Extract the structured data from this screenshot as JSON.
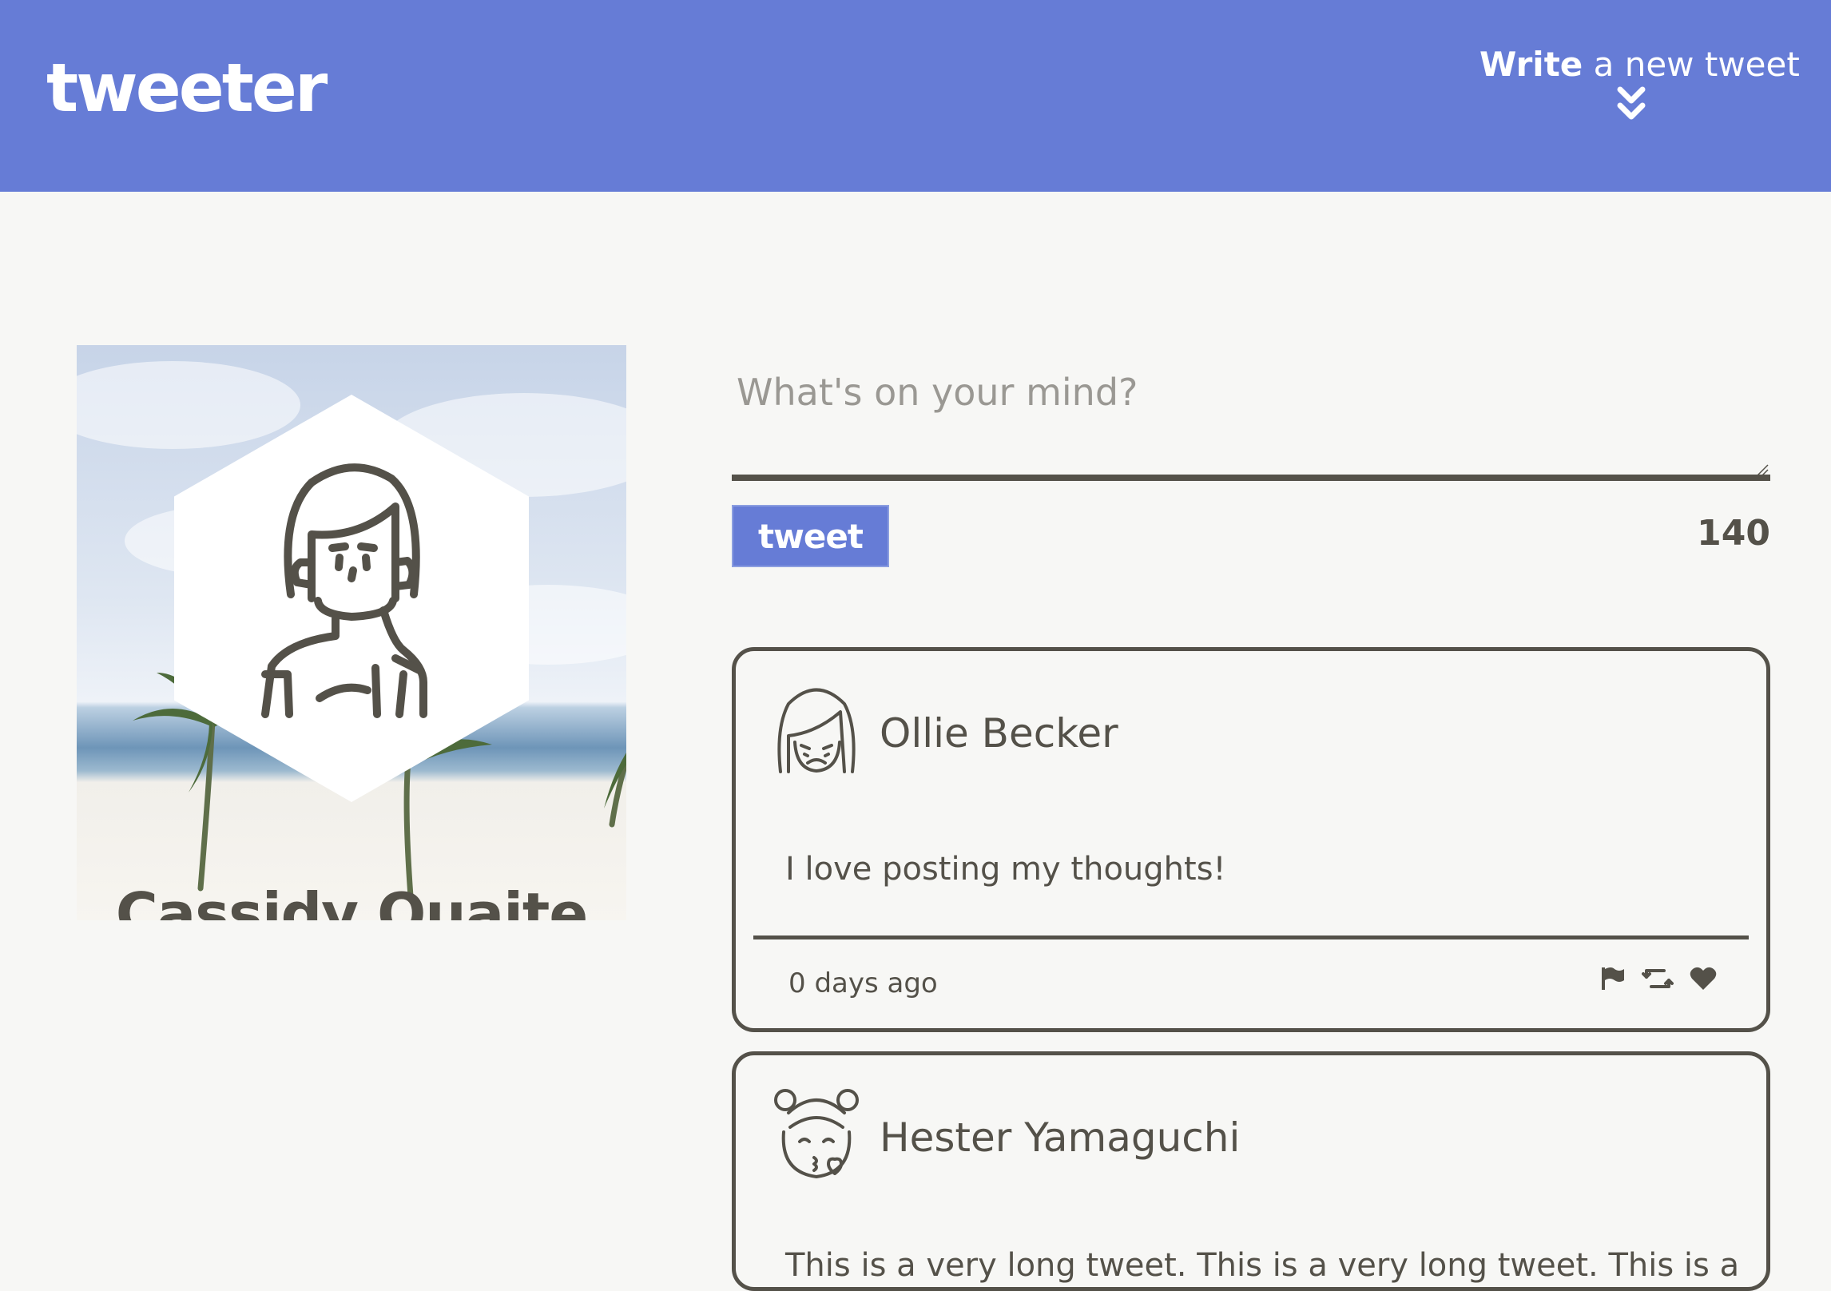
{
  "nav": {
    "brand": "tweeter",
    "compose_toggle_strong": "Write",
    "compose_toggle_rest": " a new tweet",
    "toggle_icon": "double-chevron-down-icon"
  },
  "profile": {
    "name": "Cassidy Quaite",
    "avatar_icon": "woman-avatar-icon"
  },
  "compose": {
    "placeholder": "What's on your mind?",
    "value": "",
    "button_label": "tweet",
    "counter": "140"
  },
  "tweets": [
    {
      "author": "Ollie Becker",
      "avatar_icon": "sad-girl-avatar-icon",
      "content": "I love posting my thoughts!",
      "time": "0 days ago",
      "actions": [
        "flag-icon",
        "retweet-icon",
        "heart-icon"
      ]
    },
    {
      "author": "Hester Yamaguchi",
      "avatar_icon": "kissing-girl-avatar-icon",
      "content": "This is a very long tweet. This is a very long tweet. This is a"
    }
  ],
  "colors": {
    "accent": "#667cd6",
    "text": "#545149",
    "background": "#f7f7f5"
  }
}
